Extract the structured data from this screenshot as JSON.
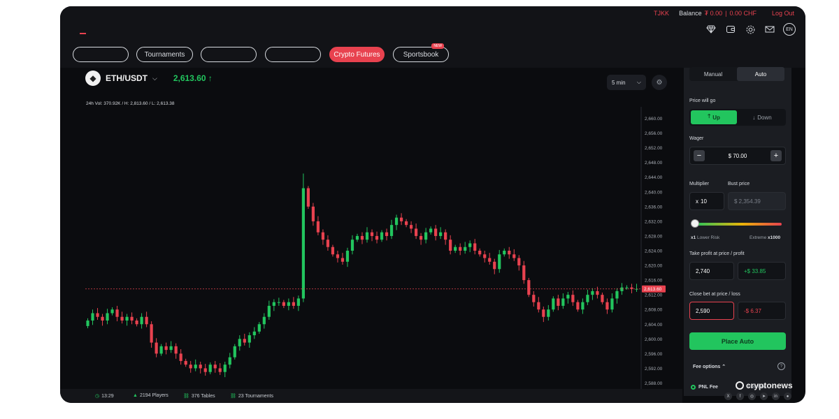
{
  "header": {
    "username": "TJKK",
    "balance_label": "Balance",
    "balance_main": "₮ 0.00",
    "balance_sep": "|",
    "balance_chf": "0.00 CHF",
    "logout_label": "Log Out",
    "lang": "EN"
  },
  "nav": {
    "items": [
      {
        "label": ""
      },
      {
        "label": "Tournaments"
      },
      {
        "label": ""
      },
      {
        "label": ""
      },
      {
        "label": "Crypto Futures",
        "active": true
      },
      {
        "label": "Sportsbook",
        "badge": "NEW"
      }
    ]
  },
  "market": {
    "pair": "ETH/USDT",
    "price": "2,613.60",
    "stats": "24h Vol: 370.92K / H: 2,813.60 / L: 2,613.38",
    "timeframe": "5 min"
  },
  "chart_data": {
    "type": "candlestick",
    "ylim": [
      2586,
      2662
    ],
    "yticks": [
      "2,660.00",
      "2,656.00",
      "2,652.00",
      "2,648.00",
      "2,644.00",
      "2,640.00",
      "2,636.00",
      "2,632.00",
      "2,628.00",
      "2,624.00",
      "2,620.00",
      "2,616.00",
      "2,612.00",
      "2,608.00",
      "2,604.00",
      "2,600.00",
      "2,596.00",
      "2,592.00",
      "2,588.00"
    ],
    "current_price": 2613.6,
    "current_label": "2,613.60",
    "up_color": "#22c55e",
    "down_color": "#e8424f",
    "closes": [
      2605,
      2607,
      2606,
      2605,
      2607,
      2608,
      2606,
      2605,
      2606,
      2605,
      2604,
      2606,
      2604,
      2599,
      2596,
      2598,
      2597,
      2598,
      2596,
      2594,
      2593,
      2592,
      2593,
      2592,
      2591,
      2593,
      2592,
      2591,
      2593,
      2595,
      2598,
      2600,
      2599,
      2601,
      2602,
      2604,
      2606,
      2609,
      2610,
      2610,
      2609,
      2610,
      2609,
      2611,
      2641,
      2636,
      2632,
      2629,
      2627,
      2625,
      2623,
      2622,
      2621,
      2624,
      2627,
      2628,
      2627,
      2629,
      2628,
      2627,
      2629,
      2628,
      2631,
      2633,
      2632,
      2631,
      2630,
      2628,
      2627,
      2629,
      2630,
      2628,
      2629,
      2627,
      2624,
      2625,
      2624,
      2625,
      2626,
      2624,
      2623,
      2622,
      2621,
      2619,
      2623,
      2624,
      2623,
      2622,
      2620,
      2616,
      2612,
      2610,
      2608,
      2606,
      2608,
      2611,
      2609,
      2611,
      2612,
      2610,
      2608,
      2610,
      2612,
      2613,
      2612,
      2610,
      2608,
      2611,
      2613,
      2614,
      2614,
      2613.6,
      2613.6
    ]
  },
  "panel": {
    "tab_manual": "Manual",
    "tab_auto": "Auto",
    "price_will_go": "Price will go",
    "up_label": "Up",
    "down_label": "Down",
    "wager_label": "Wager",
    "wager_value": "$ 70.00",
    "multiplier_label": "Multiplier",
    "bust_label": "Bust price",
    "multiplier_prefix": "x",
    "multiplier_value": "10",
    "bust_value": "$ 2,354.39",
    "risk_min": "x1",
    "risk_min_label": "Lower Risk",
    "risk_max_label": "Extreme",
    "risk_max": "x1000",
    "take_profit_label": "Take profit at price / profit",
    "take_profit_price": "2,740",
    "take_profit_amount": "+$ 33.85",
    "close_bet_label": "Close bet at price / loss",
    "close_bet_price": "2,590",
    "close_bet_amount": "-$ 6.37",
    "place_label": "Place Auto",
    "fee_options": "Fee options",
    "pnl_fee": "PNL Fee",
    "flat_fee": "Flat Fee"
  },
  "footer": {
    "time": "13:29",
    "players": "2194 Players",
    "tables": "376 Tables",
    "tournaments": "23 Tournaments"
  },
  "brand": "cryptonews"
}
